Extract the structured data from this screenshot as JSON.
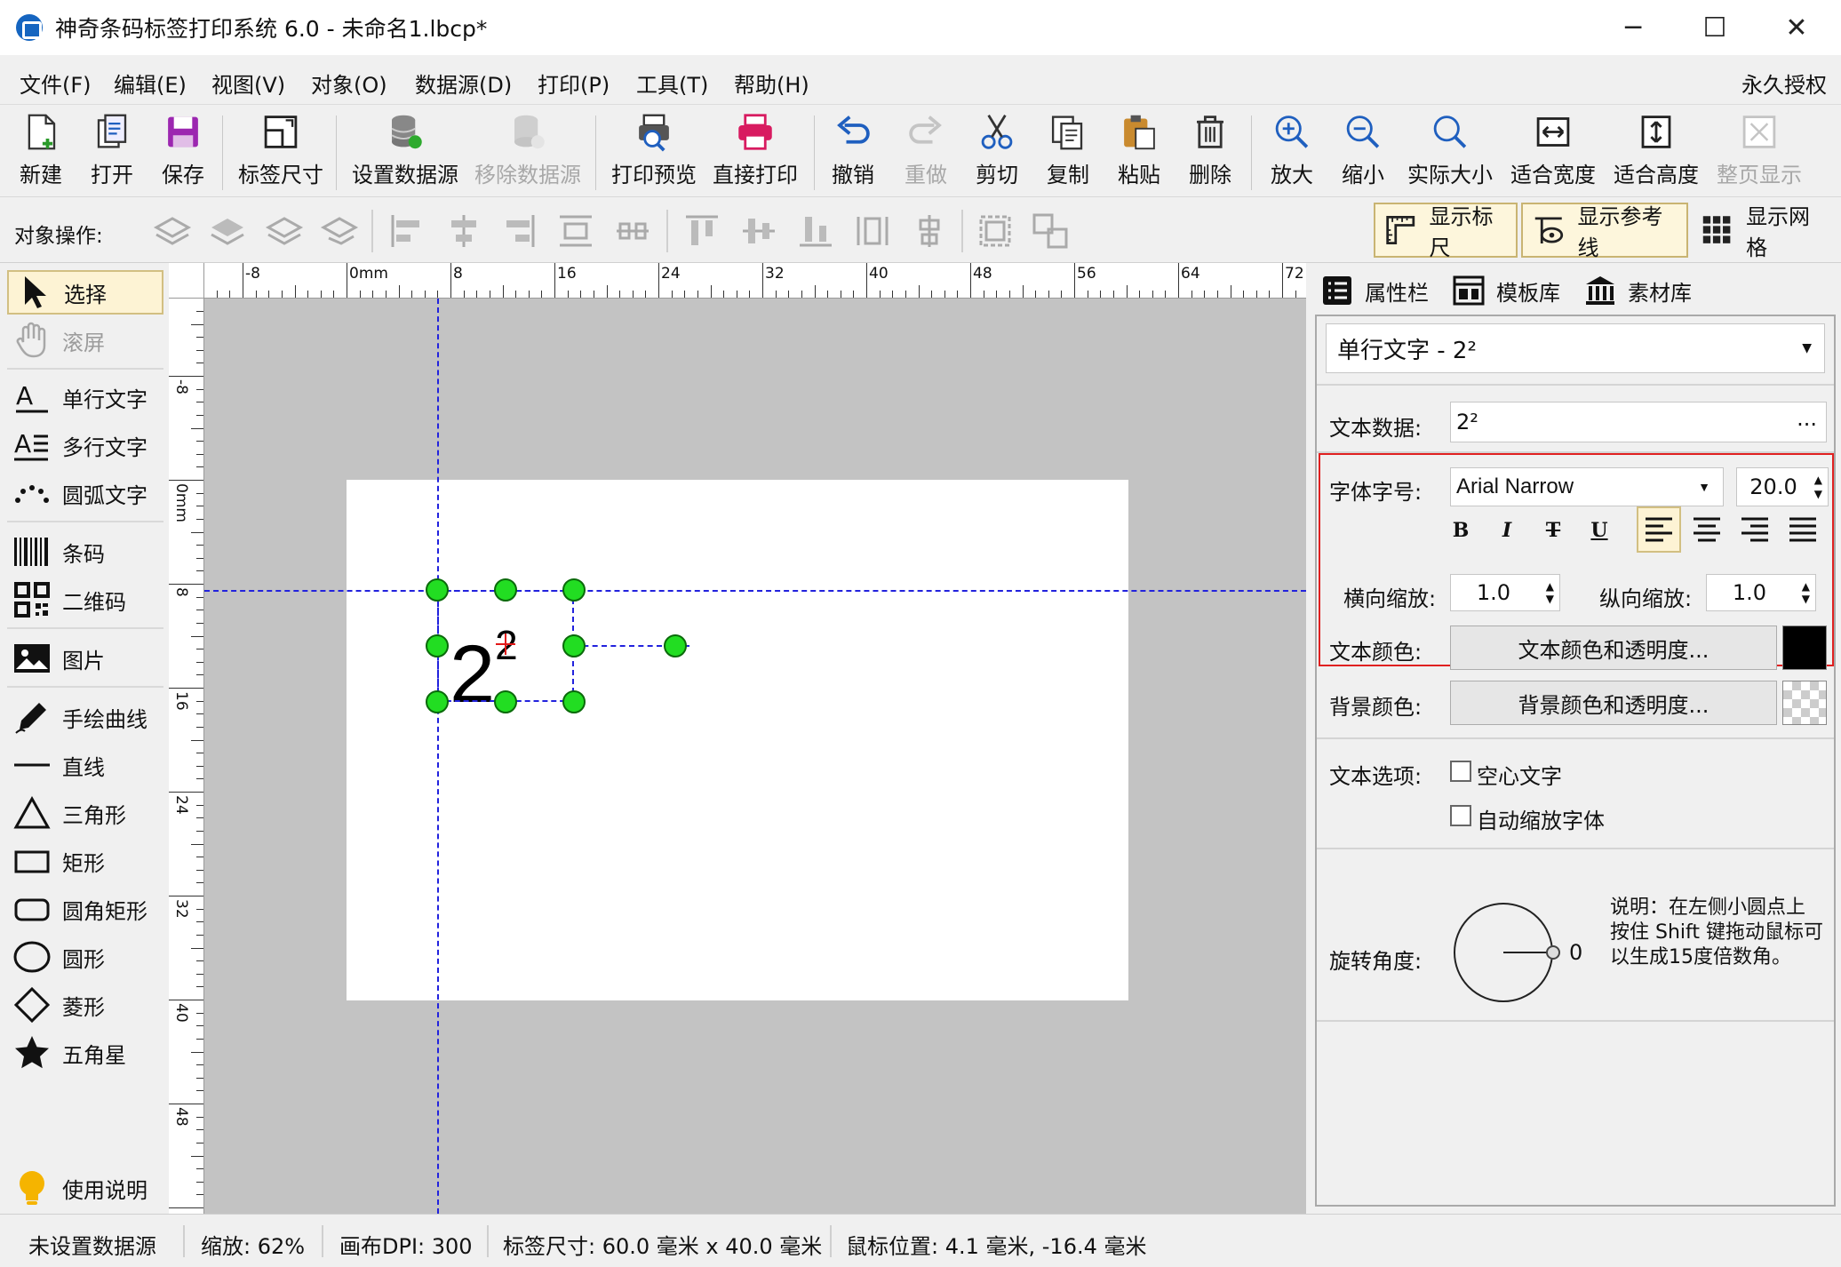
{
  "window": {
    "title": "神奇条码标签打印系统 6.0 - 未命名1.lbcp*",
    "minimize": "─",
    "maximize": "☐",
    "close": "✕"
  },
  "menu": {
    "items": [
      "文件(F)",
      "编辑(E)",
      "视图(V)",
      "对象(O)",
      "数据源(D)",
      "打印(P)",
      "工具(T)",
      "帮助(H)"
    ],
    "license": "永久授权"
  },
  "toolbar": {
    "new": "新建",
    "open": "打开",
    "save": "保存",
    "label_size": "标签尺寸",
    "set_datasource": "设置数据源",
    "remove_datasource": "移除数据源",
    "print_preview": "打印预览",
    "direct_print": "直接打印",
    "undo": "撤销",
    "redo": "重做",
    "cut": "剪切",
    "copy": "复制",
    "paste": "粘贴",
    "delete": "删除",
    "zoom_in": "放大",
    "zoom_out": "缩小",
    "actual_size": "实际大小",
    "fit_width": "适合宽度",
    "fit_height": "适合高度",
    "full_page": "整页显示"
  },
  "object_bar": {
    "label": "对象操作:",
    "show_ruler": "显示标尺",
    "show_guides": "显示参考线",
    "show_grid": "显示网格"
  },
  "tools": {
    "select": "选择",
    "scroll": "滚屏",
    "single_text": "单行文字",
    "multi_text": "多行文字",
    "arc_text": "圆弧文字",
    "barcode": "条码",
    "qrcode": "二维码",
    "image": "图片",
    "freehand": "手绘曲线",
    "line": "直线",
    "triangle": "三角形",
    "rectangle": "矩形",
    "round_rect": "圆角矩形",
    "ellipse": "圆形",
    "diamond": "菱形",
    "star": "五角星",
    "help": "使用说明"
  },
  "ruler": {
    "h_labels": [
      "-8",
      "0mm",
      "8",
      "16",
      "24",
      "32",
      "40",
      "48",
      "56",
      "64",
      "72"
    ],
    "v_labels": [
      "-8",
      "0mm",
      "8",
      "16",
      "24",
      "32",
      "40",
      "48"
    ]
  },
  "canvas": {
    "text_base": "2",
    "text_sup": "2"
  },
  "props": {
    "tabs": [
      "属性栏",
      "模板库",
      "素材库"
    ],
    "object": "单行文字 - 2²",
    "text_data_label": "文本数据:",
    "text_data_value": "2²",
    "text_data_more": "...",
    "font_label": "字体字号:",
    "font_name": "Arial Narrow",
    "font_size": "20.0",
    "bold": "B",
    "italic": "I",
    "strike": "T",
    "underline": "U",
    "hscale_label": "横向缩放:",
    "hscale": "1.0",
    "vscale_label": "纵向缩放:",
    "vscale": "1.0",
    "text_color_label": "文本颜色:",
    "text_color_btn": "文本颜色和透明度...",
    "text_color": "#000000",
    "bg_color_label": "背景颜色:",
    "bg_color_btn": "背景颜色和透明度...",
    "text_options_label": "文本选项:",
    "hollow_text": "空心文字",
    "auto_shrink": "自动缩放字体",
    "rotation_label": "旋转角度:",
    "rotation_value": "0",
    "rotation_note": "说明：在左侧小圆点上按住 Shift 键拖动鼠标可以生成15度倍数角。"
  },
  "status": {
    "datasource": "未设置数据源",
    "zoom": "缩放: 62%",
    "dpi": "画布DPI: 300",
    "label_size": "标签尺寸: 60.0 毫米 x 40.0 毫米",
    "mouse_pos": "鼠标位置: 4.1 毫米, -16.4 毫米"
  }
}
